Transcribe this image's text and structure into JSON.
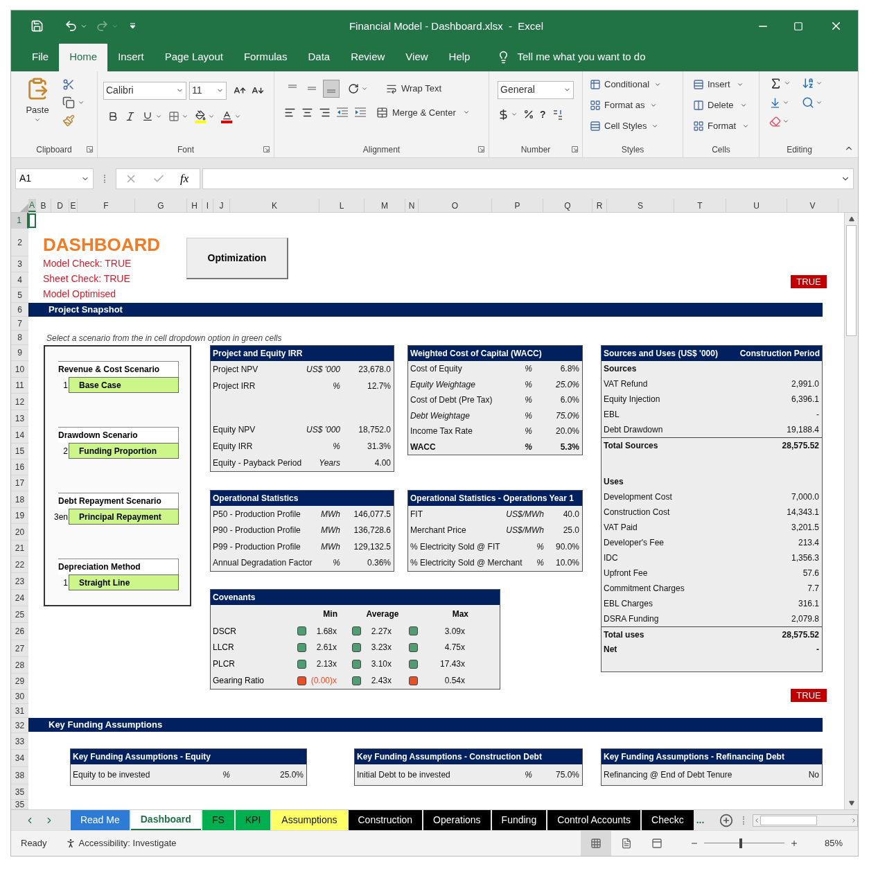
{
  "window": {
    "title": "Financial Model - Dashboard.xlsx  -  Excel"
  },
  "menu_tabs": [
    {
      "label": "File",
      "selected": false
    },
    {
      "label": "Home",
      "selected": true
    },
    {
      "label": "Insert",
      "selected": false
    },
    {
      "label": "Page Layout",
      "selected": false
    },
    {
      "label": "Formulas",
      "selected": false
    },
    {
      "label": "Data",
      "selected": false
    },
    {
      "label": "Review",
      "selected": false
    },
    {
      "label": "View",
      "selected": false
    },
    {
      "label": "Help",
      "selected": false
    }
  ],
  "tell_me": "Tell me what you want to do",
  "ribbon": {
    "clipboard": {
      "label": "Clipboard",
      "paste": "Paste"
    },
    "font": {
      "label": "Font",
      "name": "Calibri",
      "size": "11"
    },
    "alignment": {
      "label": "Alignment",
      "wrap_text": "Wrap Text",
      "merge": "Merge & Center",
      "vertical": [
        {
          "selected": false
        },
        {
          "selected": false
        },
        {
          "selected": true
        }
      ]
    },
    "number": {
      "label": "Number",
      "format": "General",
      "comma": "?"
    },
    "styles": {
      "label": "Styles",
      "items": [
        "Conditional",
        "Format as",
        "Cell Styles"
      ]
    },
    "cells": {
      "label": "Cells",
      "items": [
        "Insert",
        "Delete",
        "Format"
      ]
    },
    "editing": {
      "label": "Editing"
    }
  },
  "formula_bar": {
    "name_box": "A1",
    "fx": "fx"
  },
  "columns": [
    {
      "label": "A",
      "selected": true
    },
    {
      "label": "B",
      "selected": false
    },
    {
      "label": "D",
      "selected": false
    },
    {
      "label": "E",
      "selected": false
    },
    {
      "label": "F",
      "selected": false
    },
    {
      "label": "G",
      "selected": false
    },
    {
      "label": "H",
      "selected": false
    },
    {
      "label": "I",
      "selected": false
    },
    {
      "label": "J",
      "selected": false
    },
    {
      "label": "K",
      "selected": false
    },
    {
      "label": "L",
      "selected": false
    },
    {
      "label": "M",
      "selected": false
    },
    {
      "label": "N",
      "selected": false
    },
    {
      "label": "O",
      "selected": false
    },
    {
      "label": "P",
      "selected": false
    },
    {
      "label": "Q",
      "selected": false
    },
    {
      "label": "R",
      "selected": false
    },
    {
      "label": "S",
      "selected": false
    },
    {
      "label": "T",
      "selected": false
    },
    {
      "label": "U",
      "selected": false
    },
    {
      "label": "V",
      "selected": false
    }
  ],
  "rows": [
    {
      "label": "1",
      "selected": true
    },
    {
      "label": "2",
      "selected": false
    },
    {
      "label": "3",
      "selected": false
    },
    {
      "label": "4",
      "selected": false
    },
    {
      "label": "5",
      "selected": false
    },
    {
      "label": "6",
      "selected": false
    },
    {
      "label": "7",
      "selected": false
    },
    {
      "label": "8",
      "selected": false
    },
    {
      "label": "9",
      "selected": false
    },
    {
      "label": "10",
      "selected": false
    },
    {
      "label": "11",
      "selected": false
    },
    {
      "label": "12",
      "selected": false
    },
    {
      "label": "13",
      "selected": false
    },
    {
      "label": "14",
      "selected": false
    },
    {
      "label": "15",
      "selected": false
    },
    {
      "label": "16",
      "selected": false
    },
    {
      "label": "17",
      "selected": false
    },
    {
      "label": "18",
      "selected": false
    },
    {
      "label": "19",
      "selected": false
    },
    {
      "label": "20",
      "selected": false
    },
    {
      "label": "21",
      "selected": false
    },
    {
      "label": "22",
      "selected": false
    },
    {
      "label": "23",
      "selected": false
    },
    {
      "label": "24",
      "selected": false
    },
    {
      "label": "25",
      "selected": false
    },
    {
      "label": "26",
      "selected": false
    },
    {
      "label": "27",
      "selected": false
    },
    {
      "label": "28",
      "selected": false
    },
    {
      "label": "29",
      "selected": false
    },
    {
      "label": "30",
      "selected": false
    },
    {
      "label": "31",
      "selected": false
    },
    {
      "label": "32",
      "selected": false
    },
    {
      "label": "33",
      "selected": false
    },
    {
      "label": "34",
      "selected": false
    },
    {
      "label": "38",
      "selected": false
    },
    {
      "label": "35",
      "selected": false
    },
    {
      "label": "35",
      "selected": false
    }
  ],
  "dashboard": {
    "title": "DASHBOARD",
    "checks": [
      "Model Check: TRUE",
      "Sheet Check: TRUE",
      "Model Optimised"
    ],
    "button": "Optimization",
    "flag": "TRUE"
  },
  "section_1": "Project Snapshot",
  "hint": "Select a scenario from the in cell dropdown option in green cells",
  "scenarios": [
    {
      "label": "Revenue & Cost Scenario",
      "index": "1",
      "value": "Base Case"
    },
    {
      "label": "Drawdown Scenario",
      "index": "2",
      "value": "Funding Proportion"
    },
    {
      "label": "Debt Repayment Scenario",
      "index": "3en",
      "value": "Principal Repayment"
    },
    {
      "label": "Depreciation Method",
      "index": "1",
      "value": "Straight Line"
    }
  ],
  "irr_table": {
    "title": "Project and Equity IRR",
    "rows": [
      {
        "kind": "row",
        "label": "Project NPV",
        "unit": "US$ '000",
        "value": "23,678.0"
      },
      {
        "kind": "row",
        "label": "Project IRR",
        "unit": "%",
        "value": "12.7%"
      },
      {
        "kind": "spacer"
      },
      {
        "kind": "row",
        "label": "Equity NPV",
        "unit": "US$ '000",
        "value": "18,752.0"
      },
      {
        "kind": "row",
        "label": "Equity IRR",
        "unit": "%",
        "value": "31.3%"
      },
      {
        "kind": "row",
        "label": "Equity - Payback Period",
        "unit": "Years",
        "value": "4.00"
      }
    ]
  },
  "wacc_table": {
    "title": "Weighted Cost of Capital (WACC)",
    "rows": [
      {
        "kind": "row",
        "label": "Cost of Equity",
        "unit": "%",
        "value": "6.8%"
      },
      {
        "kind": "italic",
        "label": "Equity Weightage",
        "unit": "%",
        "value": "25.0%"
      },
      {
        "kind": "row",
        "label": "Cost of Debt (Pre Tax)",
        "unit": "%",
        "value": "6.0%"
      },
      {
        "kind": "italic",
        "label": "Debt Weightage",
        "unit": "%",
        "value": "75.0%"
      },
      {
        "kind": "row",
        "label": "Income Tax Rate",
        "unit": "%",
        "value": "20.0%"
      },
      {
        "kind": "bold",
        "label": "WACC",
        "unit": "%",
        "value": "5.3%"
      }
    ]
  },
  "ops_table": {
    "title": "Operational Statistics",
    "rows": [
      {
        "kind": "row",
        "label": "P50 - Production Profile",
        "unit": "MWh",
        "value": "146,077.5"
      },
      {
        "kind": "row",
        "label": "P90 - Production Profile",
        "unit": "MWh",
        "value": "136,728.6"
      },
      {
        "kind": "row",
        "label": "P99 - Production Profile",
        "unit": "MWh",
        "value": "129,132.5"
      },
      {
        "kind": "row",
        "label": "Annual Degradation Factor",
        "unit": "%",
        "value": "0.36%"
      }
    ]
  },
  "ops_year_table": {
    "title": "Operational Statistics - Operations Year 1",
    "rows": [
      {
        "kind": "row",
        "label": "FIT",
        "unit": "US$/MWh",
        "value": "40.0"
      },
      {
        "kind": "row",
        "label": "Merchant Price",
        "unit": "US$/MWh",
        "value": "25.0"
      },
      {
        "kind": "row",
        "label": "% Electricity Sold @ FIT",
        "unit": "%",
        "value": "90.0%"
      },
      {
        "kind": "row",
        "label": "% Electricity Sold @ Merchant",
        "unit": "%",
        "value": "10.0%"
      }
    ]
  },
  "covenants": {
    "title": "Covenants",
    "headers": [
      "Min",
      "Average",
      "Max"
    ],
    "rows": [
      {
        "label": "DSCR",
        "cells": [
          {
            "value": "1.68x",
            "color": "#4e9e72",
            "negative": false
          },
          {
            "value": "2.27x",
            "color": "#4e9e72",
            "negative": false
          },
          {
            "value": "3.09x",
            "color": "#4e9e72",
            "negative": false
          }
        ]
      },
      {
        "label": "LLCR",
        "cells": [
          {
            "value": "2.61x",
            "color": "#4e9e72",
            "negative": false
          },
          {
            "value": "3.23x",
            "color": "#4e9e72",
            "negative": false
          },
          {
            "value": "4.75x",
            "color": "#4e9e72",
            "negative": false
          }
        ]
      },
      {
        "label": "PLCR",
        "cells": [
          {
            "value": "2.13x",
            "color": "#4e9e72",
            "negative": false
          },
          {
            "value": "3.10x",
            "color": "#4e9e72",
            "negative": false
          },
          {
            "value": "17.43x",
            "color": "#4e9e72",
            "negative": false
          }
        ]
      },
      {
        "label": "Gearing Ratio",
        "cells": [
          {
            "value": "(0.00)x",
            "color": "#e8502a",
            "negative": true
          },
          {
            "value": "2.43x",
            "color": "#4e9e72",
            "negative": false
          },
          {
            "value": "0.54x",
            "color": "#e8502a",
            "negative": false
          }
        ]
      }
    ]
  },
  "sources_uses": {
    "title": "Sources and Uses (US$ '000)",
    "period": "Construction Period",
    "rows": [
      {
        "kind": "bold",
        "label": "Sources"
      },
      {
        "kind": "row",
        "label": "VAT Refund",
        "value": "2,991.0"
      },
      {
        "kind": "row",
        "label": "Equity Injection",
        "value": "6,396.1"
      },
      {
        "kind": "row",
        "label": "EBL",
        "value": "-"
      },
      {
        "kind": "row",
        "label": "Debt Drawdown",
        "value": "19,188.4"
      },
      {
        "kind": "total",
        "label": "Total Sources",
        "value": "28,575.52"
      },
      {
        "kind": "spacer"
      },
      {
        "kind": "bold",
        "label": "Uses"
      },
      {
        "kind": "row",
        "label": "Development Cost",
        "value": "7,000.0"
      },
      {
        "kind": "row",
        "label": "Construction Cost",
        "value": "14,343.1"
      },
      {
        "kind": "row",
        "label": "VAT Paid",
        "value": "3,201.5"
      },
      {
        "kind": "row",
        "label": "Developer's Fee",
        "value": "213.4"
      },
      {
        "kind": "row",
        "label": "IDC",
        "value": "1,356.3"
      },
      {
        "kind": "row",
        "label": "Upfront Fee",
        "value": "57.6"
      },
      {
        "kind": "row",
        "label": "Commitment Charges",
        "value": "7.7"
      },
      {
        "kind": "row",
        "label": "EBL Charges",
        "value": "316.1"
      },
      {
        "kind": "row",
        "label": "DSRA Funding",
        "value": "2,079.8"
      },
      {
        "kind": "total",
        "label": "Total uses",
        "value": "28,575.52"
      },
      {
        "kind": "bold",
        "label": "Net",
        "value": "-"
      }
    ]
  },
  "flag_2": "TRUE",
  "section_2": "Key Funding Assumptions",
  "funding_tables": [
    {
      "title": "Key Funding Assumptions - Equity",
      "rows": [
        {
          "kind": "row",
          "label": "Equity to be invested",
          "unit": "%",
          "value": "25.0%"
        }
      ]
    },
    {
      "title": "Key Funding Assumptions - Construction Debt",
      "rows": [
        {
          "kind": "row",
          "label": "Initial Debt to be invested",
          "unit": "%",
          "value": "75.0%"
        }
      ]
    },
    {
      "title": "Key Funding Assumptions - Refinancing Debt",
      "rows": [
        {
          "kind": "row",
          "label": "Refinancing @ End of Debt Tenure",
          "value": "No"
        }
      ]
    }
  ],
  "sheet_tabs": [
    {
      "label": "Read Me",
      "color": "#2e7bd6",
      "selected": false
    },
    {
      "label": "Dashboard",
      "color": "#ffffff",
      "selected": true
    },
    {
      "label": "FS",
      "color": "#00b050",
      "selected": false
    },
    {
      "label": "KPI",
      "color": "#00b050",
      "selected": false
    },
    {
      "label": "Assumptions",
      "color": "#ffff66",
      "selected": false
    },
    {
      "label": "Construction",
      "color": "#000000",
      "selected": false
    },
    {
      "label": "Operations",
      "color": "#000000",
      "selected": false
    },
    {
      "label": "Funding",
      "color": "#000000",
      "selected": false
    },
    {
      "label": "Control Accounts",
      "color": "#000000",
      "selected": false
    },
    {
      "label": "Checkc",
      "color": "#000000",
      "selected": false
    }
  ],
  "more_tabs": "...",
  "status_bar": {
    "ready": "Ready",
    "accessibility": "Accessibility: Investigate",
    "views": [
      {
        "selected": true
      },
      {
        "selected": false
      },
      {
        "selected": false
      }
    ],
    "zoom": {
      "level": 0.46,
      "reading": "85%"
    }
  }
}
